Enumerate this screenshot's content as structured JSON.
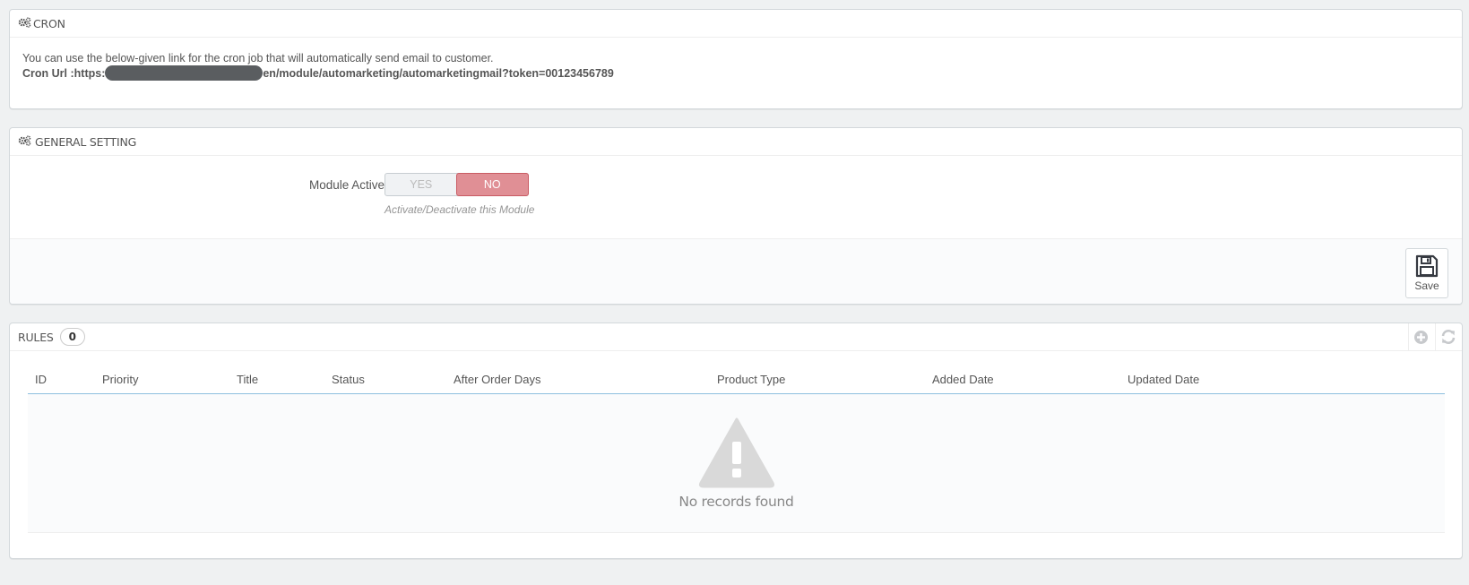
{
  "cron": {
    "title": "CRON",
    "description": "You can use the below-given link for the cron job that will automatically send email to customer.",
    "url_label": "Cron Url :",
    "url_prefix": "https:",
    "url_suffix": "en/module/automarketing/automarketingmail?token=00123456789"
  },
  "general": {
    "title": "GENERAL SETTING",
    "module_active_label": "Module Active",
    "switch_yes": "YES",
    "switch_no": "NO",
    "selected": "NO",
    "help": "Activate/Deactivate this Module",
    "save_label": "Save"
  },
  "rules": {
    "title": "RULES",
    "count": "0",
    "columns": [
      "ID",
      "Priority",
      "Title",
      "Status",
      "After Order Days",
      "Product Type",
      "Added Date",
      "Updated Date"
    ],
    "empty_text": "No records found"
  },
  "colors": {
    "switch_no_bg": "#e08f95",
    "table_header_border": "#8ebfdf",
    "page_bg": "#eff1f2"
  }
}
